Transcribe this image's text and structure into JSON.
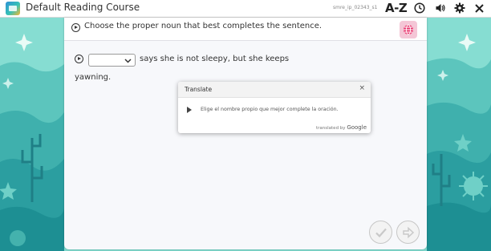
{
  "app": {
    "title": "Default Reading Course",
    "user_id": "smre_ip_02343_s1",
    "az_label": "A-Z"
  },
  "question": {
    "instruction": "Choose the proper noun that best completes the sentence.",
    "dropdown_value": "",
    "sentence_part1": "says she is not sleepy, but she keeps",
    "sentence_part2": "yawning."
  },
  "translate_popup": {
    "title": "Translate",
    "close": "×",
    "text": "Elige el nombre propio que mejor complete la oración.",
    "credit_prefix": "translated by",
    "credit_brand": "Google"
  },
  "colors": {
    "background_teal": "#7fd8cc",
    "deep_teal": "#2fa7a6",
    "globe_pink": "#e8336c"
  },
  "icons": [
    "app-logo-icon",
    "clock-icon",
    "speaker-icon",
    "gear-icon",
    "close-icon",
    "play-icon",
    "globe-icon",
    "chevron-down-icon",
    "check-icon",
    "arrow-right-icon"
  ]
}
